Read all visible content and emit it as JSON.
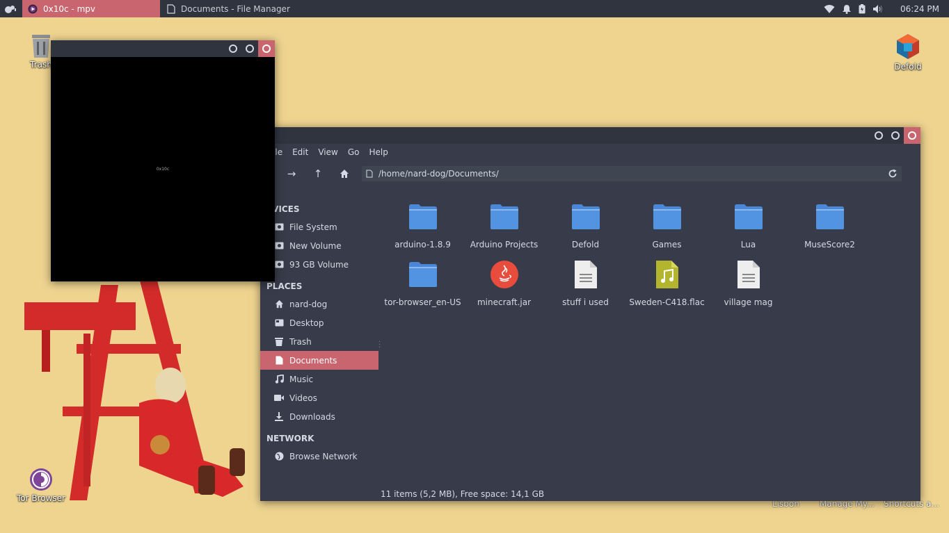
{
  "panel": {
    "tasks": [
      {
        "title": "0x10c - mpv",
        "icon": "mpv-icon"
      },
      {
        "title": "Documents - File Manager",
        "icon": "document-icon"
      }
    ],
    "tray_icons": [
      "wifi-icon",
      "bell-icon",
      "battery-icon",
      "volume-icon"
    ],
    "clock": "06:24 PM"
  },
  "desktop": {
    "icons": [
      {
        "label": "Trash",
        "icon": "trash-icon"
      },
      {
        "label": "Defold",
        "icon": "defold-icon"
      },
      {
        "label": "Tor Browser",
        "icon": "tor-icon"
      }
    ],
    "bottom_labels": [
      "Lisbon",
      "Manage My...",
      "Shortcuts a..."
    ]
  },
  "mpv": {
    "video_text": "0x10c"
  },
  "file_manager": {
    "menu": [
      "File",
      "Edit",
      "View",
      "Go",
      "Help"
    ],
    "location": "/home/nard-dog/Documents/",
    "sidebar": {
      "devices_title": "DEVICES",
      "devices": [
        {
          "label": "File System",
          "icon": "drive-icon"
        },
        {
          "label": "New Volume",
          "icon": "drive-icon"
        },
        {
          "label": "93 GB Volume",
          "icon": "drive-icon"
        }
      ],
      "places_title": "PLACES",
      "places": [
        {
          "label": "nard-dog",
          "icon": "home-icon"
        },
        {
          "label": "Desktop",
          "icon": "desktop-icon"
        },
        {
          "label": "Trash",
          "icon": "trash-icon"
        },
        {
          "label": "Documents",
          "icon": "document-icon",
          "active": true
        },
        {
          "label": "Music",
          "icon": "music-icon"
        },
        {
          "label": "Videos",
          "icon": "video-icon"
        },
        {
          "label": "Downloads",
          "icon": "download-icon"
        }
      ],
      "network_title": "NETWORK",
      "network": [
        {
          "label": "Browse Network",
          "icon": "network-icon"
        }
      ]
    },
    "files": [
      {
        "name": "arduino-1.8.9",
        "type": "folder"
      },
      {
        "name": "Arduino Projects",
        "type": "folder"
      },
      {
        "name": "Defold",
        "type": "folder"
      },
      {
        "name": "Games",
        "type": "folder"
      },
      {
        "name": "Lua",
        "type": "folder"
      },
      {
        "name": "MuseScore2",
        "type": "folder"
      },
      {
        "name": "tor-browser_en-US",
        "type": "folder"
      },
      {
        "name": "minecraft.jar",
        "type": "java"
      },
      {
        "name": "stuff i used",
        "type": "text"
      },
      {
        "name": "Sweden-C418.flac",
        "type": "audio"
      },
      {
        "name": "village mag",
        "type": "text"
      }
    ],
    "status": "11 items (5,2 MB), Free space: 14,1 GB"
  },
  "colors": {
    "accent": "#c9656f",
    "panel": "#2f343f",
    "window_bg": "#383c4a",
    "folder": "#5294e2",
    "desktop": "#efd490"
  }
}
